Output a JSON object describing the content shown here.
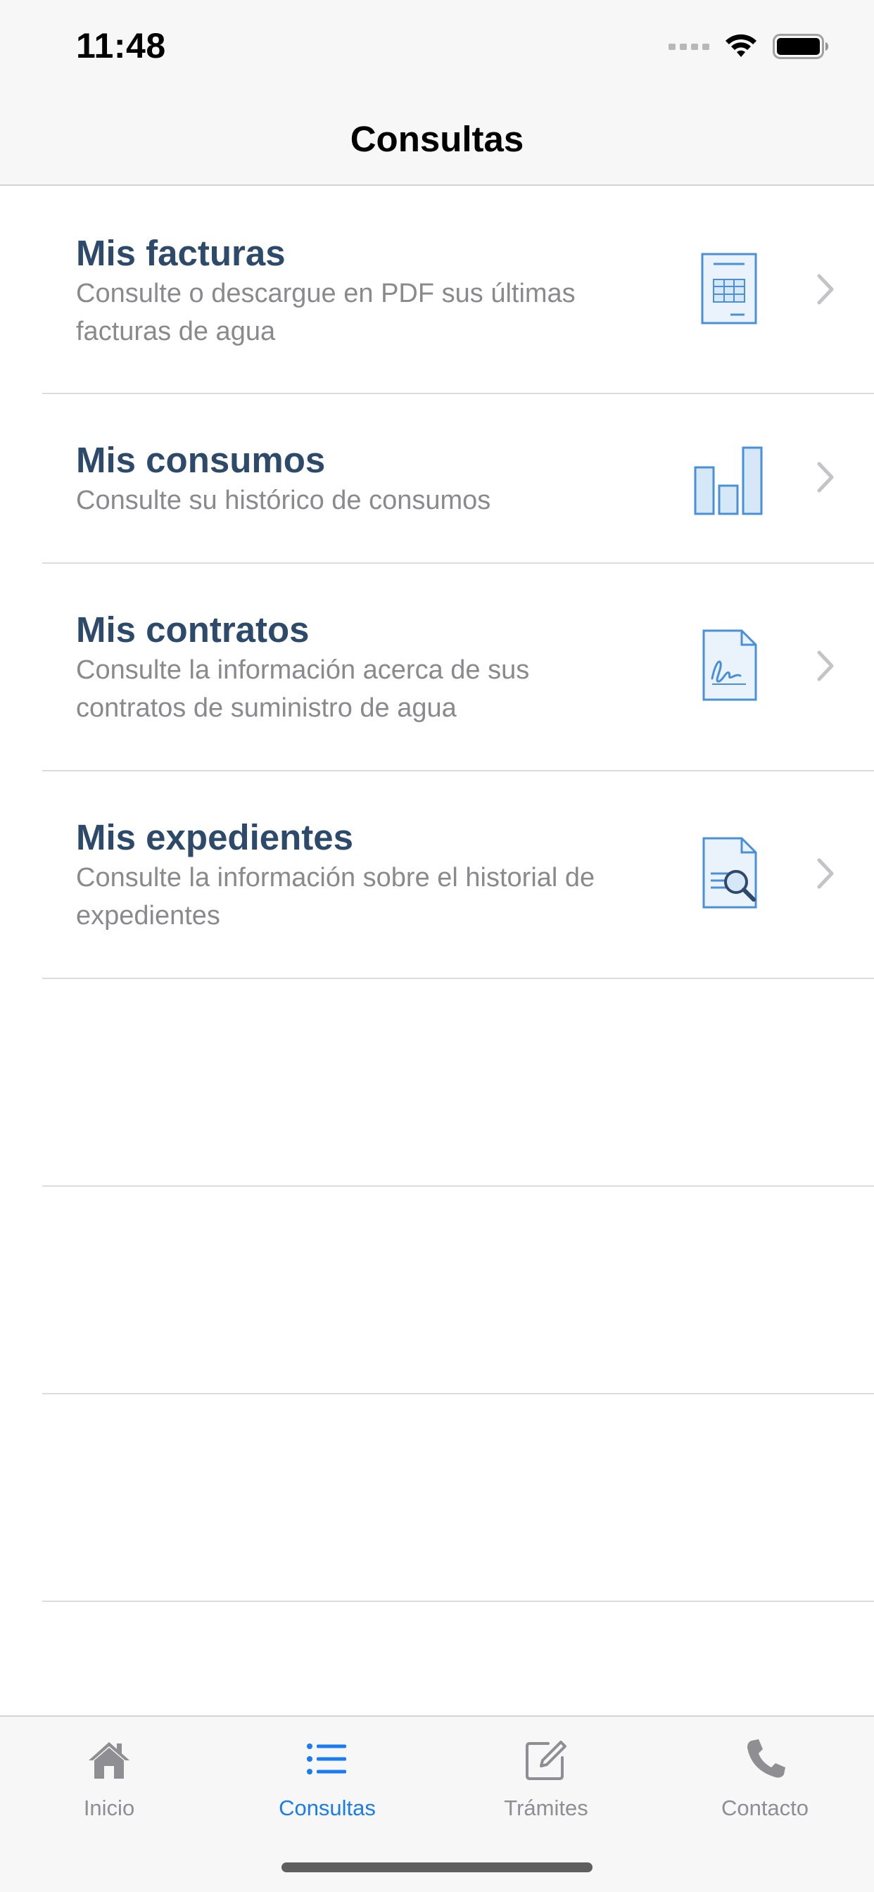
{
  "status_bar": {
    "time": "11:48"
  },
  "nav": {
    "title": "Consultas"
  },
  "menu": {
    "items": [
      {
        "title": "Mis facturas",
        "description_lines": [
          "Consulte o descargue en PDF sus últimas",
          "facturas de agua"
        ],
        "icon": "invoice-icon"
      },
      {
        "title": "Mis consumos",
        "description_lines": [
          "Consulte su histórico de consumos"
        ],
        "icon": "bar-chart-icon"
      },
      {
        "title": "Mis contratos",
        "description_lines": [
          "Consulte la información acerca de sus",
          "contratos de suministro de agua"
        ],
        "icon": "signed-contract-icon"
      },
      {
        "title": "Mis expedientes",
        "description_lines": [
          "Consulte la información sobre el historial de",
          "expedientes"
        ],
        "icon": "document-search-icon"
      }
    ]
  },
  "tab_bar": {
    "tabs": [
      {
        "label": "Inicio",
        "icon": "home-icon",
        "active": false
      },
      {
        "label": "Consultas",
        "icon": "list-icon",
        "active": true
      },
      {
        "label": "Trámites",
        "icon": "edit-icon",
        "active": false
      },
      {
        "label": "Contacto",
        "icon": "phone-icon",
        "active": false
      }
    ]
  },
  "colors": {
    "title_text": "#2e4a6b",
    "description_text": "#8a8a8e",
    "accent": "#1a7cf0",
    "icon_blue": "#4a90d9",
    "tab_inactive": "#8e8e93"
  }
}
